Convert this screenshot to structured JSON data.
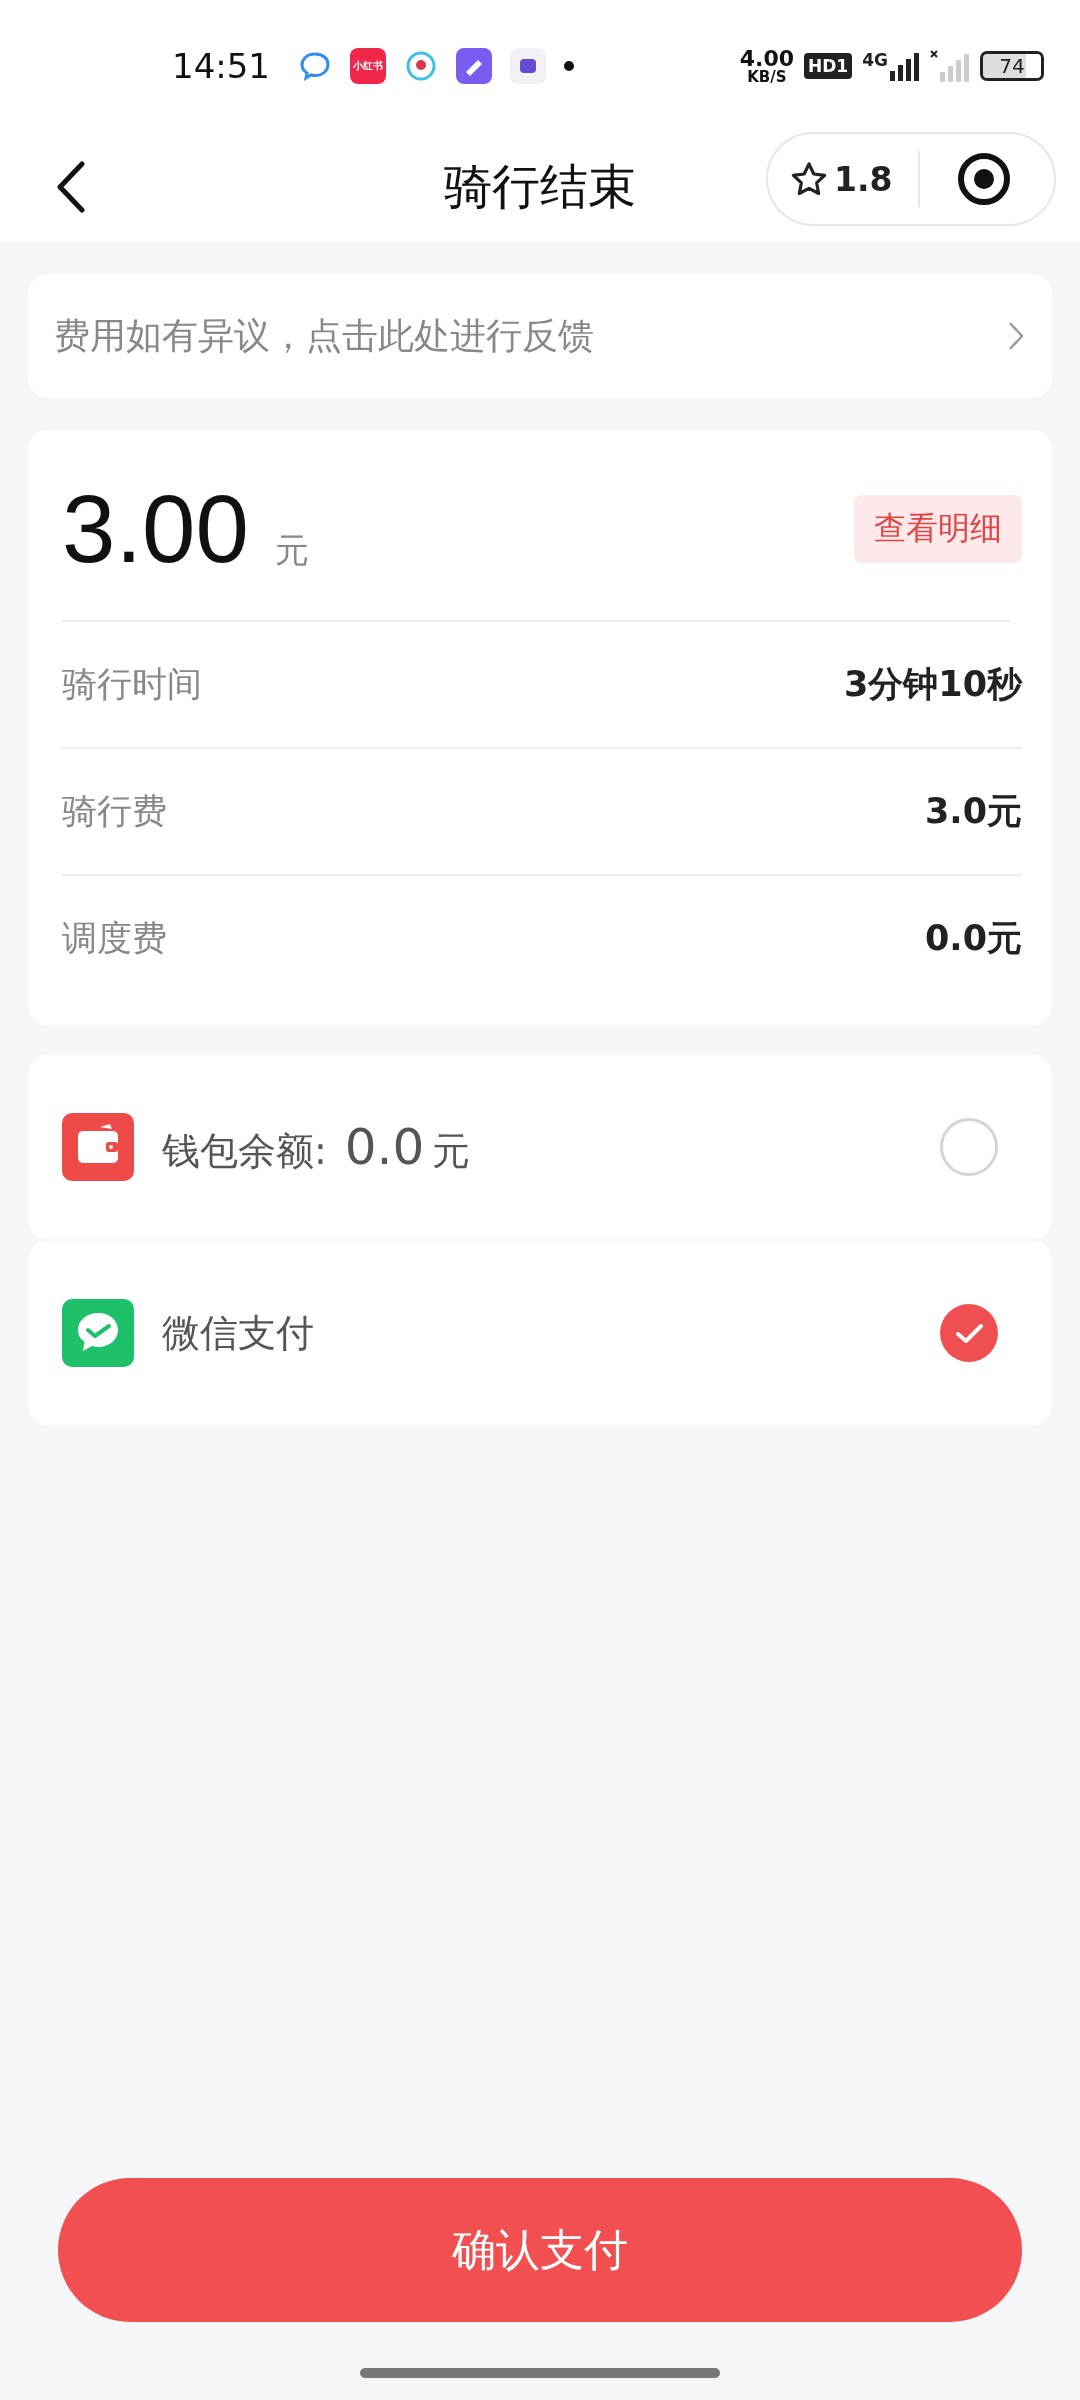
{
  "status_bar": {
    "time": "14:51",
    "app_badge_text": "小红书",
    "net_speed": "4.00",
    "net_unit": "KB/S",
    "hd_label": "HD1",
    "network_type": "4G",
    "battery": "74"
  },
  "header": {
    "title": "骑行结束",
    "rating": "1.8"
  },
  "feedback": {
    "text": "费用如有异议，点击此处进行反馈"
  },
  "fare": {
    "amount": "3.00",
    "unit": "元",
    "detail_button": "查看明细",
    "rows": [
      {
        "label": "骑行时间",
        "value": "3分钟10秒"
      },
      {
        "label": "骑行费",
        "value": "3.0元"
      },
      {
        "label": "调度费",
        "value": "0.0元"
      }
    ]
  },
  "payment_methods": [
    {
      "kind": "wallet",
      "label": "钱包余额:",
      "amount": "0.0",
      "unit": "元",
      "selected": false
    },
    {
      "kind": "wechat",
      "label": "微信支付",
      "selected": true
    }
  ],
  "confirm_button": "确认支付"
}
